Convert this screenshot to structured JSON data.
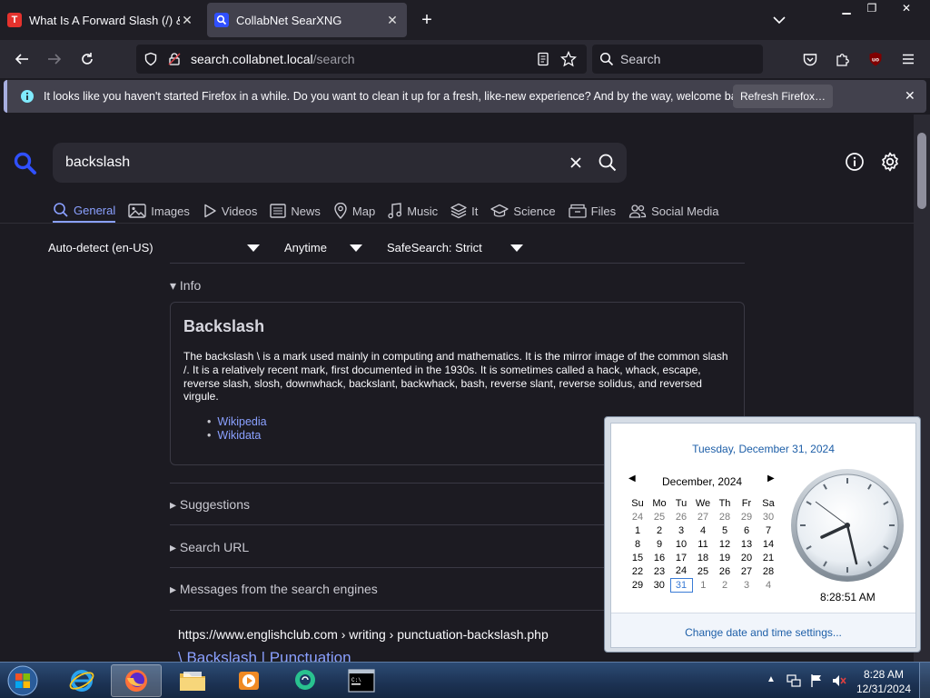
{
  "browser": {
    "tabs": [
      {
        "title": "What Is A Forward Slash (/) & H",
        "favicon_letter": "T"
      },
      {
        "title": "CollabNet SearXNG"
      }
    ],
    "url_domain": "search.collabnet.local",
    "url_path": "/search",
    "search_placeholder": "Search",
    "notification": {
      "message": "It looks like you haven't started Firefox in a while. Do you want to clean it up for a fresh, like-new experience? And by the way, welcome back!",
      "button": "Refresh Firefox…"
    }
  },
  "search": {
    "query": "backslash",
    "categories": [
      "General",
      "Images",
      "Videos",
      "News",
      "Map",
      "Music",
      "It",
      "Science",
      "Files",
      "Social Media"
    ],
    "filters": {
      "language": "Auto-detect (en-US)",
      "time": "Anytime",
      "safesearch": "SafeSearch: Strict"
    }
  },
  "infobox": {
    "section": "Info",
    "title": "Backslash",
    "description": "The backslash \\ is a mark used mainly in computing and mathematics. It is the mirror image of the common slash /. It is a relatively recent mark, first documented in the 1930s. It is sometimes called a hack, whack, escape, reverse slash, slosh, downwhack, backslant, backwhack, bash, reverse slant, reverse solidus, and reversed virgule.",
    "links": [
      "Wikipedia",
      "Wikidata"
    ]
  },
  "sections": [
    "Suggestions",
    "Search URL",
    "Messages from the search engines"
  ],
  "result": {
    "url": "https://www.englishclub.com  › writing › punctuation-backslash.php",
    "title": "\\ Backslash | Punctuation"
  },
  "clock_flyout": {
    "long_date": "Tuesday, December 31, 2024",
    "month": "December, 2024",
    "weekdays": [
      "Su",
      "Mo",
      "Tu",
      "We",
      "Th",
      "Fr",
      "Sa"
    ],
    "weeks": [
      [
        "24",
        "25",
        "26",
        "27",
        "28",
        "29",
        "30"
      ],
      [
        "1",
        "2",
        "3",
        "4",
        "5",
        "6",
        "7"
      ],
      [
        "8",
        "9",
        "10",
        "11",
        "12",
        "13",
        "14"
      ],
      [
        "15",
        "16",
        "17",
        "18",
        "19",
        "20",
        "21"
      ],
      [
        "22",
        "23",
        "24",
        "25",
        "26",
        "27",
        "28"
      ],
      [
        "29",
        "30",
        "31",
        "1",
        "2",
        "3",
        "4"
      ]
    ],
    "time": "8:28:51 AM",
    "settings_link": "Change date and time settings..."
  },
  "taskbar": {
    "time": "8:28 AM",
    "date": "12/31/2024"
  },
  "colors": {
    "accent": "#8aa0ff",
    "page_bg": "#1c1b22",
    "flyout_link": "#1e5fa8"
  }
}
